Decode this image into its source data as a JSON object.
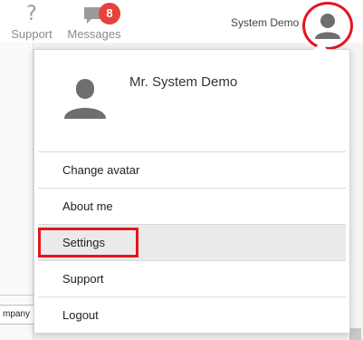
{
  "header": {
    "support_label": "Support",
    "support_icon": "question-icon",
    "messages_label": "Messages",
    "messages_icon": "chat-bubble-icon",
    "messages_count": "8",
    "username": "System Demo",
    "avatar_icon": "user-avatar-icon"
  },
  "dropdown": {
    "profile_name": "Mr. System Demo",
    "profile_avatar_icon": "user-avatar-icon",
    "items": [
      {
        "label": "Change avatar"
      },
      {
        "label": "About me"
      },
      {
        "label": "Settings"
      },
      {
        "label": "Support"
      },
      {
        "label": "Logout"
      }
    ],
    "selected_item": "Settings"
  },
  "background": {
    "field_value": "mpany"
  },
  "colors": {
    "badge": "#e8413b",
    "highlight": "#e2161f",
    "icon_gray": "#707070",
    "hover_row": "#eaeaea"
  }
}
